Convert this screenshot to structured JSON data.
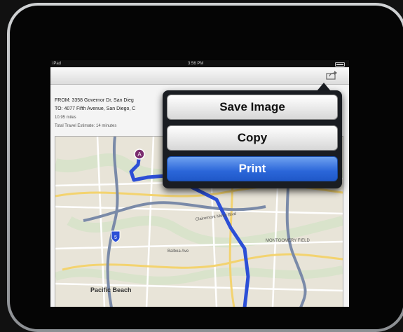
{
  "statusbar": {
    "carrier": "iPad",
    "time": "3:56 PM"
  },
  "toolbar": {
    "share_icon": "share-icon"
  },
  "route": {
    "from": "FROM: 3358 Governor Dr, San Dieg",
    "to": "TO: 4077 Fifth Avenue, San Diego, C",
    "distance": "10.95 miles",
    "estimate": "Total Travel Estimate: 14 minutes"
  },
  "menu": {
    "items": [
      "Save Image",
      "Copy",
      "Print"
    ],
    "colors": {
      "print": "#2b66d9"
    }
  },
  "map": {
    "labels": [
      "Pacific Beach",
      "MONTGOMERY FIELD",
      "Clairemont Mesa Blvd",
      "Balboa Ave"
    ],
    "markers": [
      "A"
    ],
    "shields": [
      "5"
    ]
  }
}
